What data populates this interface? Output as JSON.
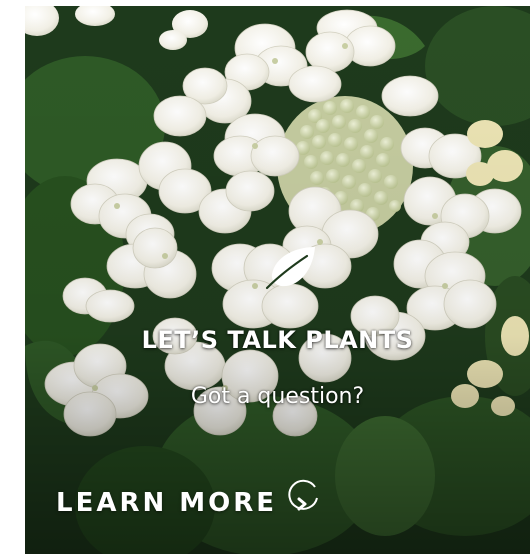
{
  "banner": {
    "headline": "LET’S TALK PLANTS",
    "subheadline": "Got a question?",
    "cta_label": "LEARN MORE",
    "icons": {
      "brand": "leaf-icon",
      "cta": "chevron-right-circle-icon"
    },
    "colors": {
      "text": "#ffffff",
      "foliage": "#1f3a1c",
      "petal": "#f4f2ea"
    }
  }
}
